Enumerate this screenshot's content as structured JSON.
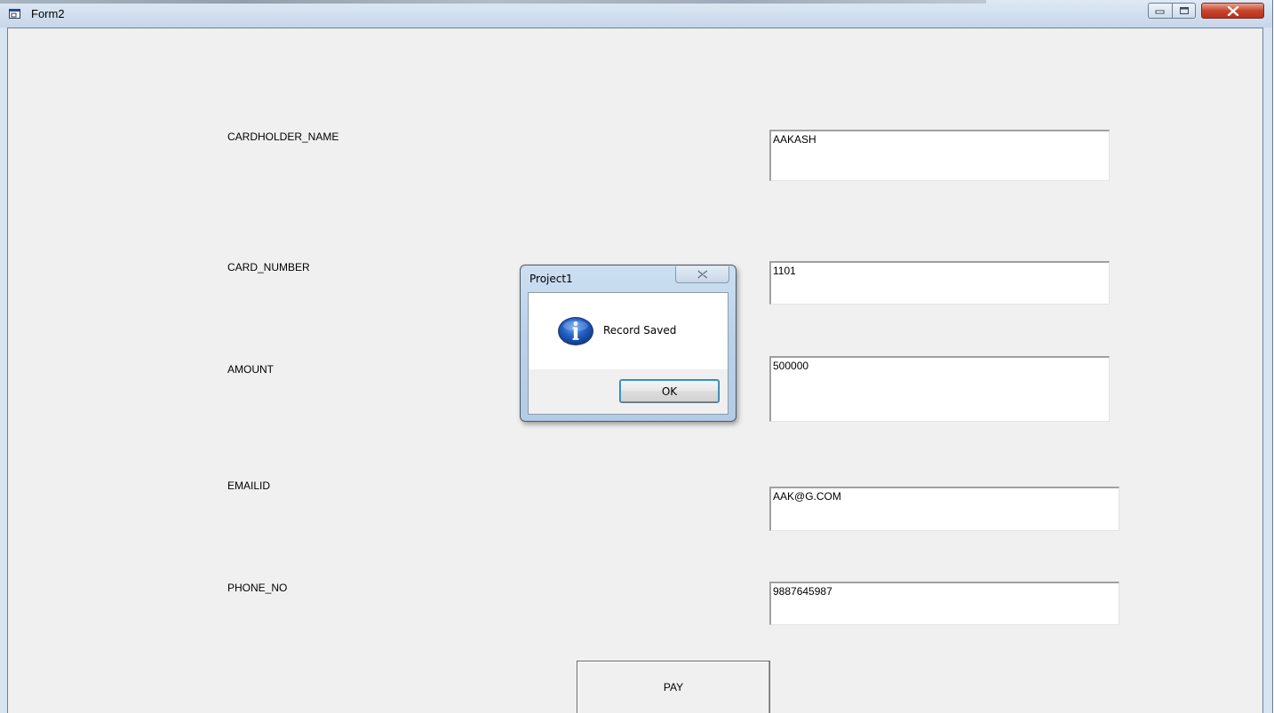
{
  "window": {
    "title": "Form2",
    "minimize_icon": "minimize-icon",
    "maximize_icon": "maximize-icon",
    "close_icon": "close-icon"
  },
  "form": {
    "fields": [
      {
        "label": "CARDHOLDER_NAME",
        "value": "AAKASH"
      },
      {
        "label": "CARD_NUMBER",
        "value": "1101"
      },
      {
        "label": "AMOUNT",
        "value": "500000"
      },
      {
        "label": "EMAILID",
        "value": "AAK@G.COM"
      },
      {
        "label": "PHONE_NO",
        "value": "9887645987"
      }
    ],
    "pay_button": "PAY"
  },
  "message_box": {
    "title": "Project1",
    "icon": "info-icon",
    "message": "Record Saved",
    "ok_button": "OK"
  },
  "colors": {
    "client_background": "#f0f0f0",
    "close_button": "#c7452d",
    "info_icon": "#1f57b6"
  }
}
